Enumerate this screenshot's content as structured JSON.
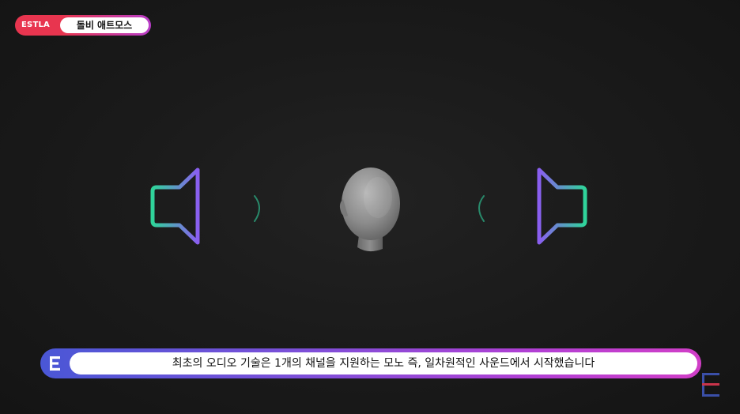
{
  "topic_tag": {
    "brand": "ESTLA",
    "title": "돌비 애트모스"
  },
  "subtitle": {
    "text": "최초의 오디오 기술은 1개의 채널을 지원하는 모노 즉, 일차원적인 사운드에서 시작했습니다"
  },
  "colors": {
    "tag_red": "#e8354f",
    "speaker_gradient_start": "#2fd49a",
    "speaker_gradient_end": "#8a5ef0",
    "subtitle_gradient_start": "#4a57d6",
    "subtitle_gradient_end": "#d13ec7"
  },
  "icons": {
    "left_speaker": "speaker-icon",
    "right_speaker": "speaker-icon",
    "head": "head-icon",
    "logo": "estla-logo-icon"
  }
}
